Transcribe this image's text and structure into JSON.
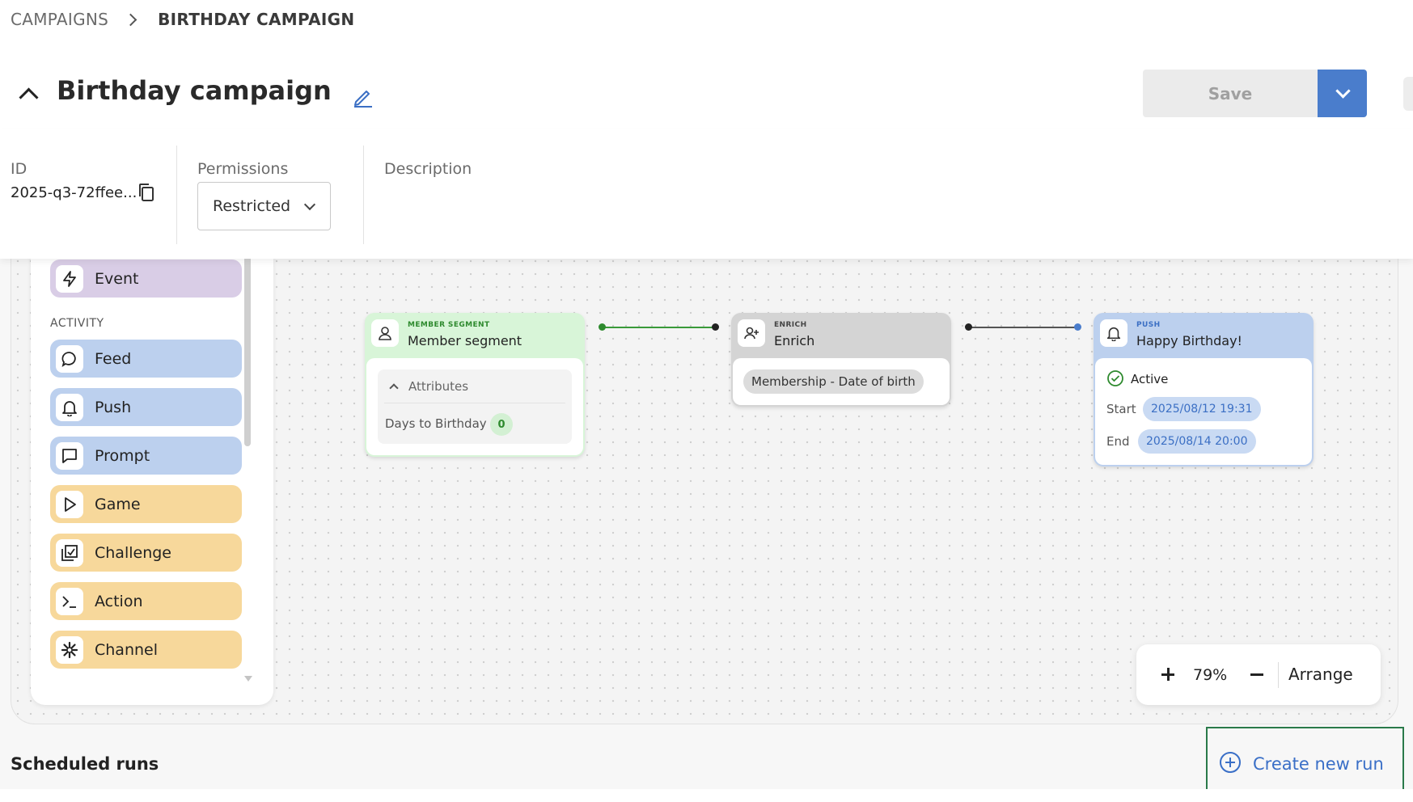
{
  "breadcrumb": {
    "parent": "CAMPAIGNS",
    "current": "BIRTHDAY CAMPAIGN"
  },
  "header": {
    "title": "Birthday campaign",
    "save_label": "Save"
  },
  "meta": {
    "id_label": "ID",
    "id_value": "2025-q3-72ffee...",
    "permissions_label": "Permissions",
    "permissions_value": "Restricted",
    "description_label": "Description"
  },
  "palette": {
    "event_label": "Event",
    "activity_section": "ACTIVITY",
    "items": [
      {
        "label": "Feed",
        "icon": "chat-bubble-icon",
        "color": "#bcd0ee"
      },
      {
        "label": "Push",
        "icon": "bell-icon",
        "color": "#bcd0ee"
      },
      {
        "label": "Prompt",
        "icon": "prompt-icon",
        "color": "#bcd0ee"
      },
      {
        "label": "Game",
        "icon": "play-icon",
        "color": "#f7d89b"
      },
      {
        "label": "Challenge",
        "icon": "challenge-icon",
        "color": "#f7d89b"
      },
      {
        "label": "Action",
        "icon": "terminal-icon",
        "color": "#f7d89b"
      },
      {
        "label": "Channel",
        "icon": "asterisk-icon",
        "color": "#f7d89b"
      }
    ]
  },
  "nodes": {
    "segment": {
      "kind": "MEMBER SEGMENT",
      "name": "Member segment",
      "attributes_label": "Attributes",
      "attribute_name": "Days to Birthday",
      "attribute_value": "0"
    },
    "enrich": {
      "kind": "ENRICH",
      "name": "Enrich",
      "field": "Membership - Date of birth"
    },
    "push": {
      "kind": "PUSH",
      "name": "Happy Birthday!",
      "status": "Active",
      "start_label": "Start",
      "start_value": "2025/08/12 19:31",
      "end_label": "End",
      "end_value": "2025/08/14 20:00"
    }
  },
  "zoom": {
    "value": "79%",
    "arrange_label": "Arrange"
  },
  "scheduled_runs": {
    "title": "Scheduled runs",
    "create_label": "Create new run"
  },
  "colors": {
    "accent_blue": "#4a7dcc",
    "segment_green": "#d8f5d8",
    "enrich_grey": "#d4d4d4",
    "push_blue": "#bcd0ee"
  }
}
